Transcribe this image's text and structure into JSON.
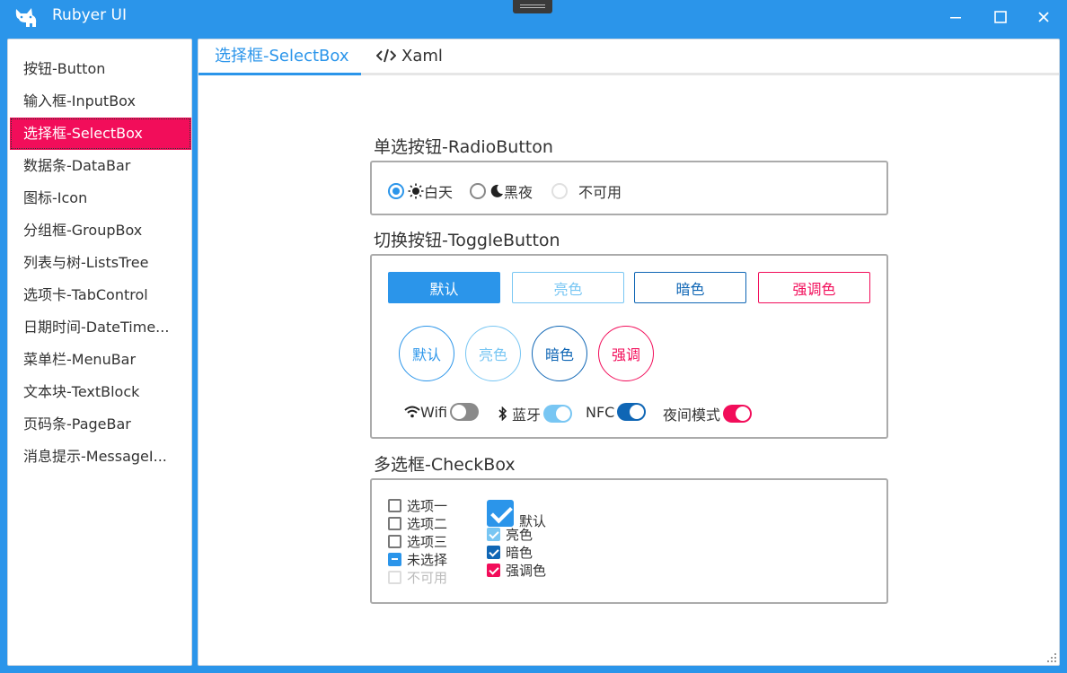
{
  "window": {
    "title": "Rubyer UI",
    "colors": {
      "primary": "#2B95EA",
      "accent": "#F20D5A",
      "dark": "#0F66B5",
      "light": "#78C6F3"
    }
  },
  "sidebar": {
    "items": [
      {
        "label": "按钮-Button"
      },
      {
        "label": "输入框-InputBox"
      },
      {
        "label": "选择框-SelectBox",
        "active": true
      },
      {
        "label": "数据条-DataBar"
      },
      {
        "label": "图标-Icon"
      },
      {
        "label": "分组框-GroupBox"
      },
      {
        "label": "列表与树-ListsTree"
      },
      {
        "label": "选项卡-TabControl"
      },
      {
        "label": "日期时间-DateTime..."
      },
      {
        "label": "菜单栏-MenuBar"
      },
      {
        "label": "文本块-TextBlock"
      },
      {
        "label": "页码条-PageBar"
      },
      {
        "label": "消息提示-MessageI..."
      }
    ]
  },
  "tabs": [
    {
      "label": "选择框-SelectBox",
      "selected": true
    },
    {
      "label": "Xaml",
      "icon": "code-icon"
    }
  ],
  "radio_section": {
    "title": "单选按钮-RadioButton",
    "options": [
      {
        "label": "白天",
        "icon": "sun-icon",
        "checked": true
      },
      {
        "label": "黑夜",
        "icon": "moon-icon",
        "checked": false
      },
      {
        "label": "不可用",
        "disabled": true
      }
    ]
  },
  "toggle_section": {
    "title": "切换按钮-ToggleButton",
    "rect_buttons": [
      "默认",
      "亮色",
      "暗色",
      "强调色"
    ],
    "circle_buttons": [
      "默认",
      "亮色",
      "暗色",
      "强调"
    ],
    "switches": [
      {
        "label": "Wifi",
        "icon": "wifi-icon",
        "on": false
      },
      {
        "label": "蓝牙",
        "icon": "bluetooth-icon",
        "on": true
      },
      {
        "label": "NFC",
        "on": true
      },
      {
        "label": "夜间模式",
        "on": true
      }
    ]
  },
  "checkbox_section": {
    "title": "多选框-CheckBox",
    "left": [
      {
        "label": "选项一",
        "state": "unchecked"
      },
      {
        "label": "选项二",
        "state": "unchecked"
      },
      {
        "label": "选项三",
        "state": "unchecked"
      },
      {
        "label": "未选择",
        "state": "indeterminate"
      },
      {
        "label": "不可用",
        "state": "disabled"
      }
    ],
    "right": [
      {
        "label": "默认",
        "state": "checked"
      },
      {
        "label": "亮色",
        "state": "checked"
      },
      {
        "label": "暗色",
        "state": "checked"
      },
      {
        "label": "强调色",
        "state": "checked"
      }
    ]
  }
}
